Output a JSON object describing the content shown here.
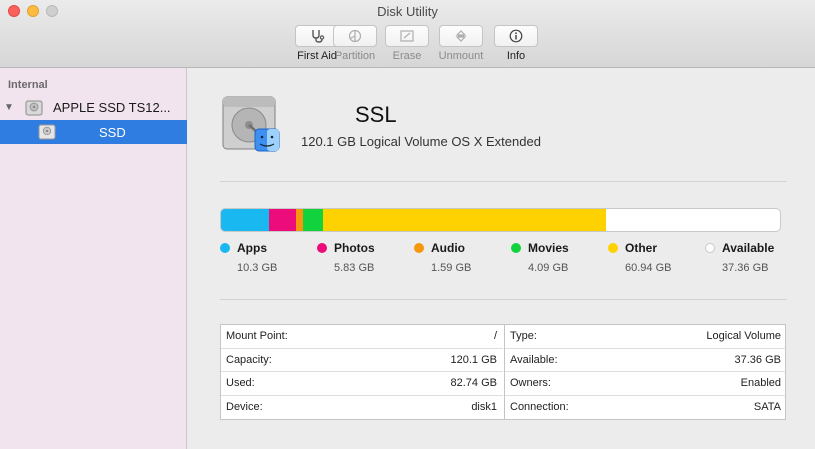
{
  "window": {
    "title": "Disk Utility"
  },
  "toolbar": {
    "first_aid": "First Aid",
    "partition": "Partition",
    "erase": "Erase",
    "unmount": "Unmount",
    "info": "Info"
  },
  "sidebar": {
    "section": "Internal",
    "disk": {
      "name": "APPLE SSD TS12...",
      "icon": "hard-drive-icon"
    },
    "volume": {
      "name": "SSD",
      "icon": "hard-drive-icon",
      "selected": true
    }
  },
  "volume": {
    "name": "SSL",
    "description": "120.1 GB Logical Volume OS X Extended"
  },
  "usage": {
    "total_gb": 120.1,
    "categories": [
      {
        "name": "Apps",
        "value": "10.3 GB",
        "gb": 10.3,
        "color": "#1ab8f0"
      },
      {
        "name": "Photos",
        "value": "5.83 GB",
        "gb": 5.83,
        "color": "#ec0c7b"
      },
      {
        "name": "Audio",
        "value": "1.59 GB",
        "gb": 1.59,
        "color": "#f8960e"
      },
      {
        "name": "Movies",
        "value": "4.09 GB",
        "gb": 4.09,
        "color": "#12d33d"
      },
      {
        "name": "Other",
        "value": "60.94 GB",
        "gb": 60.94,
        "color": "#fdd200"
      },
      {
        "name": "Available",
        "value": "37.36 GB",
        "gb": 37.36,
        "color": "#ffffff"
      }
    ]
  },
  "info": {
    "left": [
      {
        "key": "Mount Point:",
        "value": "/"
      },
      {
        "key": "Capacity:",
        "value": "120.1 GB"
      },
      {
        "key": "Used:",
        "value": "82.74 GB"
      },
      {
        "key": "Device:",
        "value": "disk1"
      }
    ],
    "right": [
      {
        "key": "Type:",
        "value": "Logical Volume"
      },
      {
        "key": "Available:",
        "value": "37.36 GB"
      },
      {
        "key": "Owners:",
        "value": "Enabled"
      },
      {
        "key": "Connection:",
        "value": "SATA"
      }
    ]
  }
}
